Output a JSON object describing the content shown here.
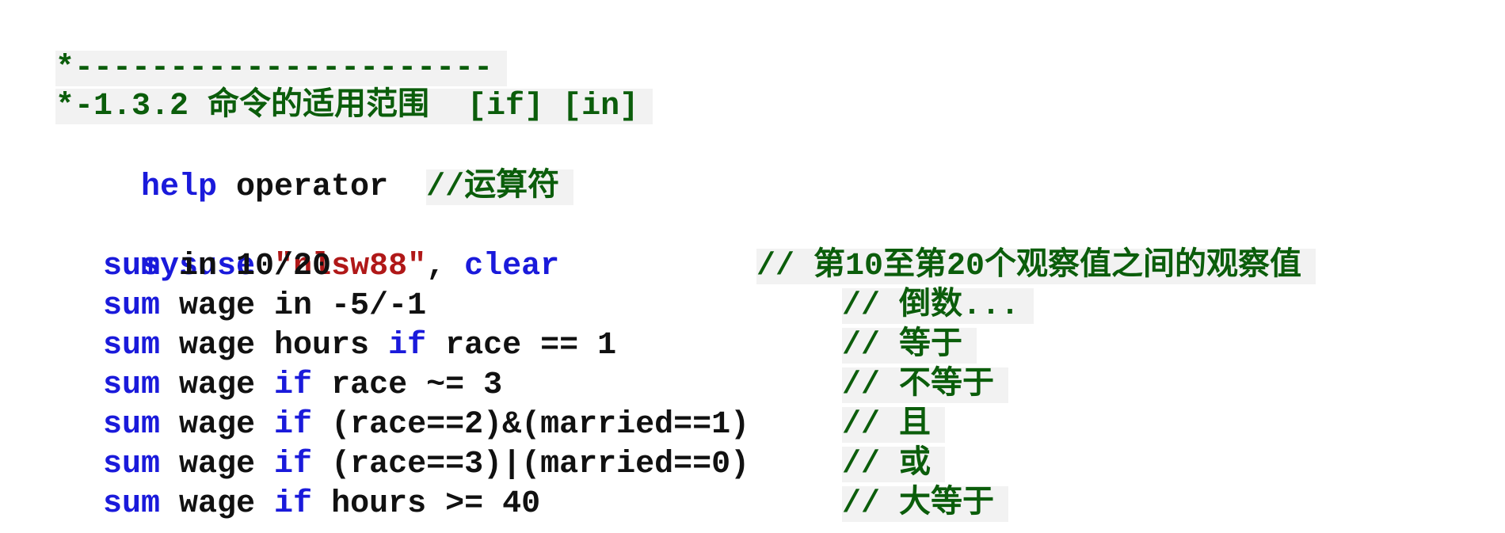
{
  "header": {
    "divider": "*----------------------",
    "title": "*-1.3.2 命令的适用范围  [if] [in]"
  },
  "help_line": {
    "cmd": "help",
    "arg": " operator  ",
    "comment": "//运算符"
  },
  "sysuse_line": {
    "cmd": "sysuse",
    "space": " ",
    "string": "\"nlsw88\"",
    "comma": ", ",
    "option": "clear"
  },
  "code_lines": [
    {
      "cmd": "sum",
      "parts": [
        {
          "type": "plain",
          "text": " in 10/20"
        }
      ],
      "comment": "// 第10至第20个观察值之间的观察值"
    },
    {
      "cmd": "sum",
      "parts": [
        {
          "type": "plain",
          "text": " wage in -5/-1"
        }
      ],
      "comment": "// 倒数..."
    },
    {
      "cmd": "sum",
      "parts": [
        {
          "type": "plain",
          "text": " wage hours "
        },
        {
          "type": "kw",
          "text": "if"
        },
        {
          "type": "plain",
          "text": " race == 1"
        }
      ],
      "comment": "// 等于"
    },
    {
      "cmd": "sum",
      "parts": [
        {
          "type": "plain",
          "text": " wage "
        },
        {
          "type": "kw",
          "text": "if"
        },
        {
          "type": "plain",
          "text": " race ~= 3"
        }
      ],
      "comment": "// 不等于"
    },
    {
      "cmd": "sum",
      "parts": [
        {
          "type": "plain",
          "text": " wage "
        },
        {
          "type": "kw",
          "text": "if"
        },
        {
          "type": "plain",
          "text": " (race==2)&(married==1)"
        }
      ],
      "comment": "// 且"
    },
    {
      "cmd": "sum",
      "parts": [
        {
          "type": "plain",
          "text": " wage "
        },
        {
          "type": "kw",
          "text": "if"
        },
        {
          "type": "plain",
          "text": " (race==3)|(married==0)"
        }
      ],
      "comment": "// 或"
    },
    {
      "cmd": "sum",
      "parts": [
        {
          "type": "plain",
          "text": " wage "
        },
        {
          "type": "kw",
          "text": "if"
        },
        {
          "type": "plain",
          "text": " hours >= 40"
        }
      ],
      "comment": "// 大等于"
    }
  ],
  "colors": {
    "comment": "#0b5d0b",
    "keyword": "#1a1adb",
    "string": "#b01818",
    "text": "#111111",
    "highlight": "#f2f2f2"
  }
}
